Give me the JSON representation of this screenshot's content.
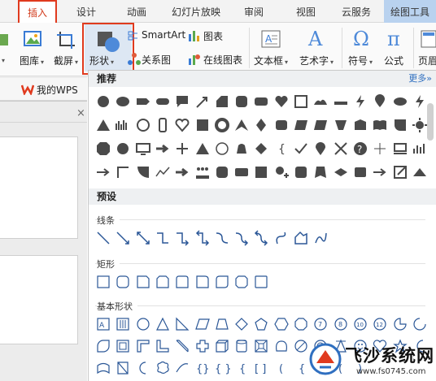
{
  "tabs": [
    {
      "label": "插入",
      "active": true
    },
    {
      "label": "设计"
    },
    {
      "label": "动画"
    },
    {
      "label": "幻灯片放映"
    },
    {
      "label": "审阅"
    },
    {
      "label": "视图"
    },
    {
      "label": "云服务"
    },
    {
      "label": "绘图工具",
      "highlight": true
    }
  ],
  "ribbon": {
    "gallery_label": "图库",
    "screenshot_label": "截屏",
    "shape_label": "形状",
    "smartart_label": "SmartArt",
    "chart_label": "图表",
    "relation_label": "关系图",
    "online_chart_label": "在线图表",
    "textbox_label": "文本框",
    "wordart_label": "艺术字",
    "symbol_label": "符号",
    "formula_label": "公式",
    "header_label": "页眉"
  },
  "sidebar": {
    "wps_label": "我的WPS",
    "close": "×"
  },
  "panel": {
    "recommend": "推荐",
    "more": "更多»",
    "preset": "预设",
    "categories": [
      "线条",
      "矩形",
      "基本形状"
    ]
  },
  "watermark": {
    "name": "飞沙系统网",
    "url": "www.fs0745.com"
  },
  "colors": {
    "accent": "#e03a1e",
    "shape_fill": "#4a4a4a",
    "outline": "#2b5797",
    "link": "#2f6fc0"
  }
}
